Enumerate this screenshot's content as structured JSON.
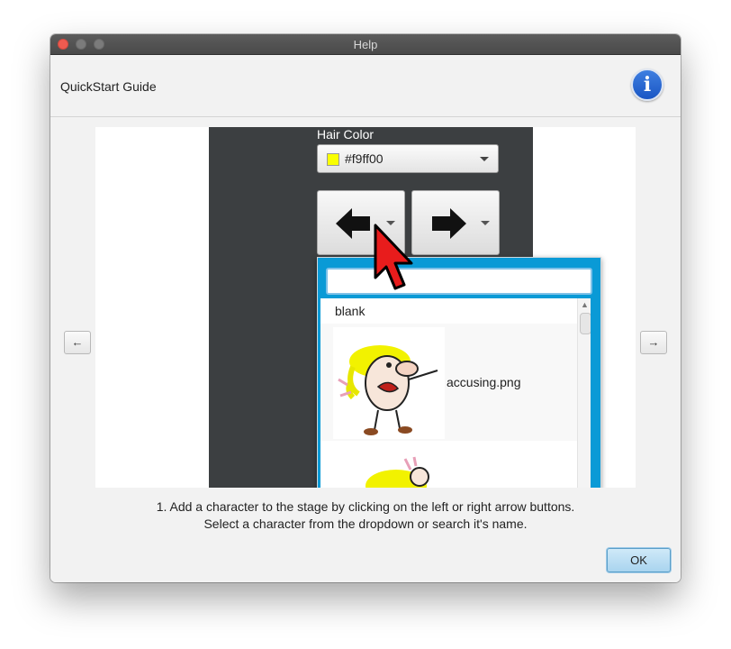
{
  "window": {
    "title": "Help"
  },
  "header": {
    "title": "QuickStart Guide",
    "info_icon": "info-icon"
  },
  "navigation": {
    "prev_label": "←",
    "next_label": "→"
  },
  "slide": {
    "hair_color_label": "Hair Color",
    "hair_color_value": "#f9ff00",
    "hair_color_swatch": "#f9ff00",
    "left_arrow_icon": "arrow-left-icon",
    "right_arrow_icon": "arrow-right-icon",
    "dropdown": {
      "search_value": "",
      "items": [
        "blank",
        "accusing.png"
      ]
    }
  },
  "captions": {
    "line1": "1. Add a character to the stage by clicking on the left or right arrow buttons.",
    "line2": "Select a character from the dropdown or search it's name."
  },
  "footer": {
    "ok_label": "OK"
  },
  "colors": {
    "dropdown_border": "#0a9ad6",
    "dark_panel": "#3c3f41",
    "info_blue": "#1a56c4",
    "cursor_red": "#e81c1c"
  }
}
